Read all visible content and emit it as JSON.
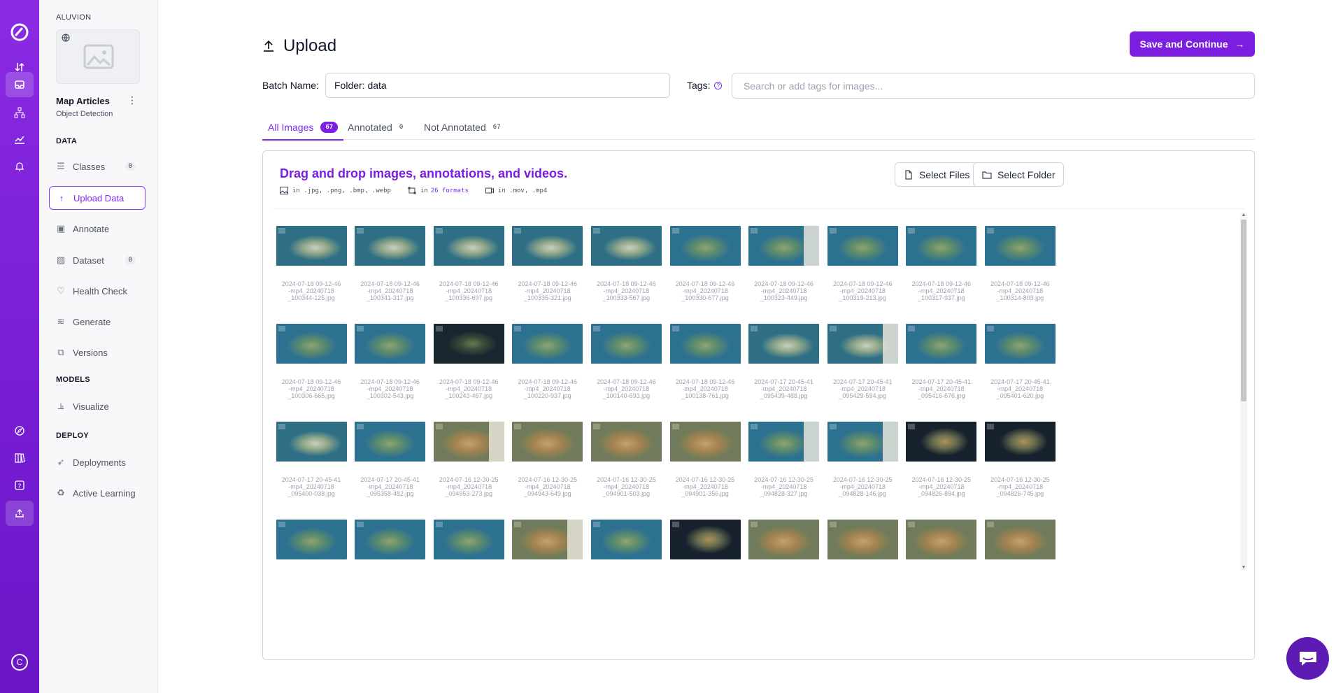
{
  "rail": {
    "items": [
      "logo",
      "transfer-icon",
      "inbox-icon",
      "hierarchy-icon",
      "chart-icon",
      "bell-icon",
      "compass-icon",
      "book-icon",
      "help-icon",
      "upload-icon"
    ],
    "avatar_letter": "C"
  },
  "sidebar": {
    "workspace": "ALUVION",
    "project_title": "Map Articles",
    "project_type": "Object Detection",
    "sections": {
      "data": "DATA",
      "models": "MODELS",
      "deploy": "DEPLOY"
    },
    "items": [
      {
        "label": "Classes",
        "icon": "list-icon",
        "count": "0"
      },
      {
        "label": "Upload Data",
        "icon": "upload-arrow-icon",
        "active": true
      },
      {
        "label": "Annotate",
        "icon": "annotate-icon"
      },
      {
        "label": "Dataset",
        "icon": "image-icon",
        "count": "0"
      },
      {
        "label": "Health Check",
        "icon": "heart-icon"
      },
      {
        "label": "Generate",
        "icon": "layers-icon"
      },
      {
        "label": "Versions",
        "icon": "versions-icon"
      },
      {
        "label": "Visualize",
        "icon": "visualize-icon"
      },
      {
        "label": "Deployments",
        "icon": "rocket-icon"
      },
      {
        "label": "Active Learning",
        "icon": "recycle-icon"
      }
    ]
  },
  "header": {
    "title": "Upload",
    "save_label": "Save and Continue"
  },
  "form": {
    "batch_label": "Batch Name:",
    "batch_value": "Folder: data",
    "tags_label": "Tags:",
    "tags_placeholder": "Search or add tags for images..."
  },
  "tabs": [
    {
      "label": "All Images",
      "count": "67",
      "active": true
    },
    {
      "label": "Annotated",
      "count": "0"
    },
    {
      "label": "Not Annotated",
      "count": "67"
    }
  ],
  "dropzone": {
    "title": "Drag and drop images, annotations, and videos.",
    "images_formats": "in .jpg, .png, .bmp, .webp",
    "annot_prefix": "in",
    "annot_link": "26 formats",
    "video_formats": "in .mov, .mp4",
    "select_files": "Select Files",
    "select_folder": "Select Folder"
  },
  "images": [
    {
      "line1": "2024-07-18 09-12-46",
      "line2": "-mp4_20240718",
      "line3": "_100344-125.jpg",
      "style": "blue"
    },
    {
      "line1": "2024-07-18 09-12-46",
      "line2": "-mp4_20240718",
      "line3": "_100341-317.jpg",
      "style": "blue"
    },
    {
      "line1": "2024-07-18 09-12-46",
      "line2": "-mp4_20240718",
      "line3": "_100336-697.jpg",
      "style": "blue"
    },
    {
      "line1": "2024-07-18 09-12-46",
      "line2": "-mp4_20240718",
      "line3": "_100335-321.jpg",
      "style": "blue"
    },
    {
      "line1": "2024-07-18 09-12-46",
      "line2": "-mp4_20240718",
      "line3": "_100333-567.jpg",
      "style": "blue"
    },
    {
      "line1": "2024-07-18 09-12-46",
      "line2": "-mp4_20240718",
      "line3": "_100330-677.jpg",
      "style": "green"
    },
    {
      "line1": "2024-07-18 09-12-46",
      "line2": "-mp4_20240718",
      "line3": "_100323-449.jpg",
      "style": "green",
      "panel": true
    },
    {
      "line1": "2024-07-18 09-12-46",
      "line2": "-mp4_20240718",
      "line3": "_100319-213.jpg",
      "style": "green"
    },
    {
      "line1": "2024-07-18 09-12-46",
      "line2": "-mp4_20240718",
      "line3": "_100317-937.jpg",
      "style": "green"
    },
    {
      "line1": "2024-07-18 09-12-46",
      "line2": "-mp4_20240718",
      "line3": "_100314-803.jpg",
      "style": "green"
    },
    {
      "line1": "2024-07-18 09-12-46",
      "line2": "-mp4_20240718",
      "line3": "_100306-665.jpg",
      "style": "green"
    },
    {
      "line1": "2024-07-18 09-12-46",
      "line2": "-mp4_20240718",
      "line3": "_100302-543.jpg",
      "style": "green"
    },
    {
      "line1": "2024-07-18 09-12-46",
      "line2": "-mp4_20240718",
      "line3": "_100243-467.jpg",
      "style": "night"
    },
    {
      "line1": "2024-07-18 09-12-46",
      "line2": "-mp4_20240718",
      "line3": "_100220-937.jpg",
      "style": "green"
    },
    {
      "line1": "2024-07-18 09-12-46",
      "line2": "-mp4_20240718",
      "line3": "_100140-693.jpg",
      "style": "green"
    },
    {
      "line1": "2024-07-18 09-12-46",
      "line2": "-mp4_20240718",
      "line3": "_100138-761.jpg",
      "style": "green"
    },
    {
      "line1": "2024-07-17 20-45-41",
      "line2": "-mp4_20240718",
      "line3": "_095439-488.jpg",
      "style": "blue"
    },
    {
      "line1": "2024-07-17 20-45-41",
      "line2": "-mp4_20240718",
      "line3": "_095429-594.jpg",
      "style": "blue",
      "panel": true
    },
    {
      "line1": "2024-07-17 20-45-41",
      "line2": "-mp4_20240718",
      "line3": "_095416-676.jpg",
      "style": "green"
    },
    {
      "line1": "2024-07-17 20-45-41",
      "line2": "-mp4_20240718",
      "line3": "_095401-620.jpg",
      "style": "green"
    },
    {
      "line1": "2024-07-17 20-45-41",
      "line2": "-mp4_20240718",
      "line3": "_095400-038.jpg",
      "style": "blue"
    },
    {
      "line1": "2024-07-17 20-45-41",
      "line2": "-mp4_20240718",
      "line3": "_095358-482.jpg",
      "style": "green"
    },
    {
      "line1": "2024-07-16 12-30-25",
      "line2": "-mp4_20240718",
      "line3": "_094953-273.jpg",
      "style": "sand",
      "panel": true
    },
    {
      "line1": "2024-07-16 12-30-25",
      "line2": "-mp4_20240718",
      "line3": "_094943-649.jpg",
      "style": "sand"
    },
    {
      "line1": "2024-07-16 12-30-25",
      "line2": "-mp4_20240718",
      "line3": "_094901-503.jpg",
      "style": "sand"
    },
    {
      "line1": "2024-07-16 12-30-25",
      "line2": "-mp4_20240718",
      "line3": "_094901-356.jpg",
      "style": "sand"
    },
    {
      "line1": "2024-07-16 12-30-25",
      "line2": "-mp4_20240718",
      "line3": "_094828-327.jpg",
      "style": "green",
      "panel": true
    },
    {
      "line1": "2024-07-16 12-30-25",
      "line2": "-mp4_20240718",
      "line3": "_094828-146.jpg",
      "style": "green",
      "panel": true
    },
    {
      "line1": "2024-07-16 12-30-25",
      "line2": "-mp4_20240718",
      "line3": "_094826-894.jpg",
      "style": "dark"
    },
    {
      "line1": "2024-07-16 12-30-25",
      "line2": "-mp4_20240718",
      "line3": "_094826-745.jpg",
      "style": "dark"
    },
    {
      "line1": "",
      "line2": "",
      "line3": "",
      "style": "green"
    },
    {
      "line1": "",
      "line2": "",
      "line3": "",
      "style": "green"
    },
    {
      "line1": "",
      "line2": "",
      "line3": "",
      "style": "green"
    },
    {
      "line1": "",
      "line2": "",
      "line3": "",
      "style": "sand",
      "panel": true
    },
    {
      "line1": "",
      "line2": "",
      "line3": "",
      "style": "green"
    },
    {
      "line1": "",
      "line2": "",
      "line3": "",
      "style": "dark"
    },
    {
      "line1": "",
      "line2": "",
      "line3": "",
      "style": "sand"
    },
    {
      "line1": "",
      "line2": "",
      "line3": "",
      "style": "sand"
    },
    {
      "line1": "",
      "line2": "",
      "line3": "",
      "style": "sand"
    },
    {
      "line1": "",
      "line2": "",
      "line3": "",
      "style": "sand"
    }
  ],
  "colors": {
    "accent": "#7c1ee0",
    "rail_top": "#8a2be2",
    "rail_bottom": "#6a16c6"
  }
}
